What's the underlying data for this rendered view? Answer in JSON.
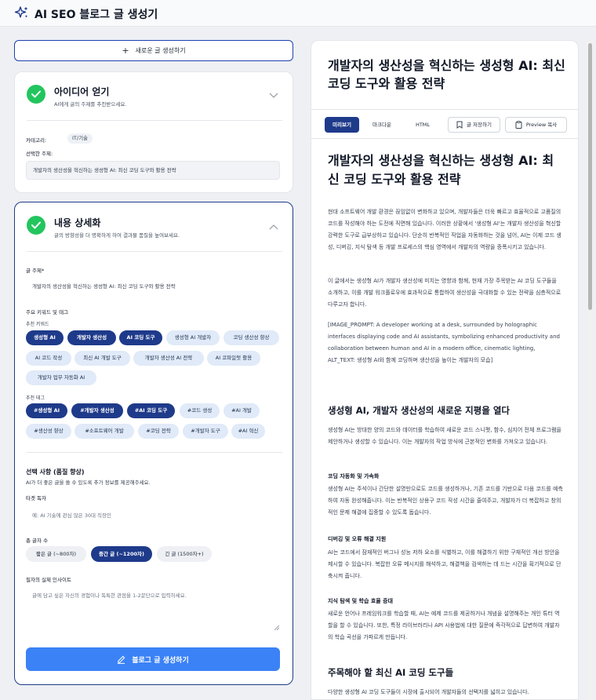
{
  "header": {
    "title": "AI SEO 블로그 글 생성기",
    "icon": "sparkle-icon"
  },
  "new_button": {
    "label": "새로운 글 생성하기"
  },
  "step1": {
    "title": "아이디어 얻기",
    "subtitle": "AI에게 글의 주제를 추천받으세요.",
    "category_label": "카테고리:",
    "category_value": "IT/기술",
    "selected_topic_label": "선택한 주제:",
    "selected_topic": "개발자의 생산성을 혁신하는 생성형 AI: 최신 코딩 도구와 활용 전략"
  },
  "step2": {
    "title": "내용 상세화",
    "subtitle": "글의 방향성을 더 명확하게 하여 결과물 품질을 높여보세요.",
    "topic_label": "글 주제*",
    "topic_value": "개발자의 생산성을 혁신하는 생성형 AI: 최신 코딩 도구와 활용 전략",
    "kw_section": "주요 키워드 및 태그",
    "kw_label": "추천 키워드",
    "keywords": [
      "생성형 AI",
      "개발자 생산성",
      "AI 코딩 도구",
      "생성형 AI 개발자",
      "코딩 생산성 향상",
      "AI 코드 작성",
      "최신 AI 개발 도구",
      "개발자 생산성 AI 전략",
      "AI 코파일럿 활용",
      "개발자 업무 자동화 AI"
    ],
    "tag_label": "추천 태그",
    "tags": [
      "#생성형 AI",
      "#개발자 생산성",
      "#AI 코딩 도구",
      "#코드 생성",
      "#AI 개발",
      "#생산성 향상",
      "#소프트웨어 개발",
      "#코딩 전략",
      "#개발자 도구",
      "#AI 혁신"
    ],
    "opt_title": "선택 사항 (품질 향상)",
    "opt_sub": "AI가 더 좋은 글을 쓸 수 있도록 추가 정보를 제공해주세요.",
    "target_label": "타겟 독자",
    "target_placeholder": "예: AI 기술에 관심 많은 30대 직장인",
    "len_label": "총 글자 수",
    "lengths": [
      "짧은 글 (~800자)",
      "중간 글 (~1200자)",
      "긴 글 (1500자+)"
    ],
    "insight_label": "필자의 실제 인사이트",
    "insight_placeholder": "글에 담고 싶은 자신의 경험이나 독특한 관점을 1-2문단으로 입력하세요.",
    "gen_button": "블로그 글 생성하기"
  },
  "preview": {
    "title": "개발자의 생산성을 혁신하는 생성형 AI: 최신 코딩 도구와 활용 전략",
    "tabs": [
      "미리보기",
      "마크다운",
      "HTML"
    ],
    "save_label": "글 저장하기",
    "copy_label": "Preview 복사",
    "h1": "개발자의 생산성을 혁신하는 생성형 AI: 최신 코딩 도구와 활용 전략",
    "p1": "현대 소프트웨어 개발 환경은 끊임없이 변화하고 있으며, 개발자들은 더욱 빠르고 효율적으로 고품질의 코드를 작성해야 하는 도전에 직면해 있습니다. 이러한 상황에서 '생성형 AI'는 개발자 생산성을 혁신할 강력한 도구로 급부상하고 있습니다. 단순히 반복적인 작업을 자동화하는 것을 넘어, AI는 이제 코드 생성, 디버깅, 지식 탐색 등 개발 프로세스의 핵심 영역에서 개발자의 역량을 증폭시키고 있습니다.",
    "p2": "이 글에서는 생성형 AI가 개발자 생산성에 미치는 영향과 함께, 현재 가장 주목받는 AI 코딩 도구들을 소개하고, 이를 개발 워크플로우에 효과적으로 통합하여 생산성을 극대화할 수 있는 전략을 심층적으로 다루고자 합니다.",
    "p3": "[IMAGE_PROMPT: A developer working at a desk, surrounded by holographic interfaces displaying code and AI assistants, symbolizing enhanced productivity and collaboration between human and AI in a modern office, cinematic lighting, ALT_TEXT: 생성형 AI와 함께 코딩하며 생산성을 높이는 개발자의 모습]",
    "h2a": "생성형 AI, 개발자 생산성의 새로운 지평을 열다",
    "p4": "생성형 AI는 방대한 양의 코드와 데이터를 학습하여 새로운 코드 스니펫, 함수, 심지어 전체 프로그램을 제안하거나 생성할 수 있습니다. 이는 개발자의 작업 방식에 근본적인 변화를 가져오고 있습니다.",
    "h3a": "코딩 자동화 및 가속화",
    "p5": "생성형 AI는 주석이나 간단한 설명만으로도 코드를 생성하거나, 기존 코드를 기반으로 다음 코드를 예측하여 자동 완성해줍니다. 이는 반복적인 상용구 코드 작성 시간을 줄여주고, 개발자가 더 복잡하고 창의적인 문제 해결에 집중할 수 있도록 돕습니다.",
    "h3b": "디버깅 및 오류 해결 지원",
    "p6": "AI는 코드에서 잠재적인 버그나 성능 저하 요소를 식별하고, 이를 해결하기 위한 구체적인 개선 방안을 제시할 수 있습니다. 복잡한 오류 메시지를 해석하고, 해결책을 검색하는 데 드는 시간을 획기적으로 단축시켜 줍니다.",
    "h3c": "지식 탐색 및 학습 효율 증대",
    "p7": "새로운 언어나 프레임워크를 학습할 때, AI는 예제 코드를 제공하거나 개념을 설명해주는 개인 튜터 역할을 할 수 있습니다. 또한, 특정 라이브러리나 API 사용법에 대한 질문에 즉각적으로 답변하여 개발자의 학습 곡선을 가파르게 만듭니다.",
    "h2b": "주목해야 할 최신 AI 코딩 도구들",
    "p8": "다양한 생성형 AI 코딩 도구들이 시장에 출시되어 개발자들의 선택지를 넓히고 있습니다."
  }
}
